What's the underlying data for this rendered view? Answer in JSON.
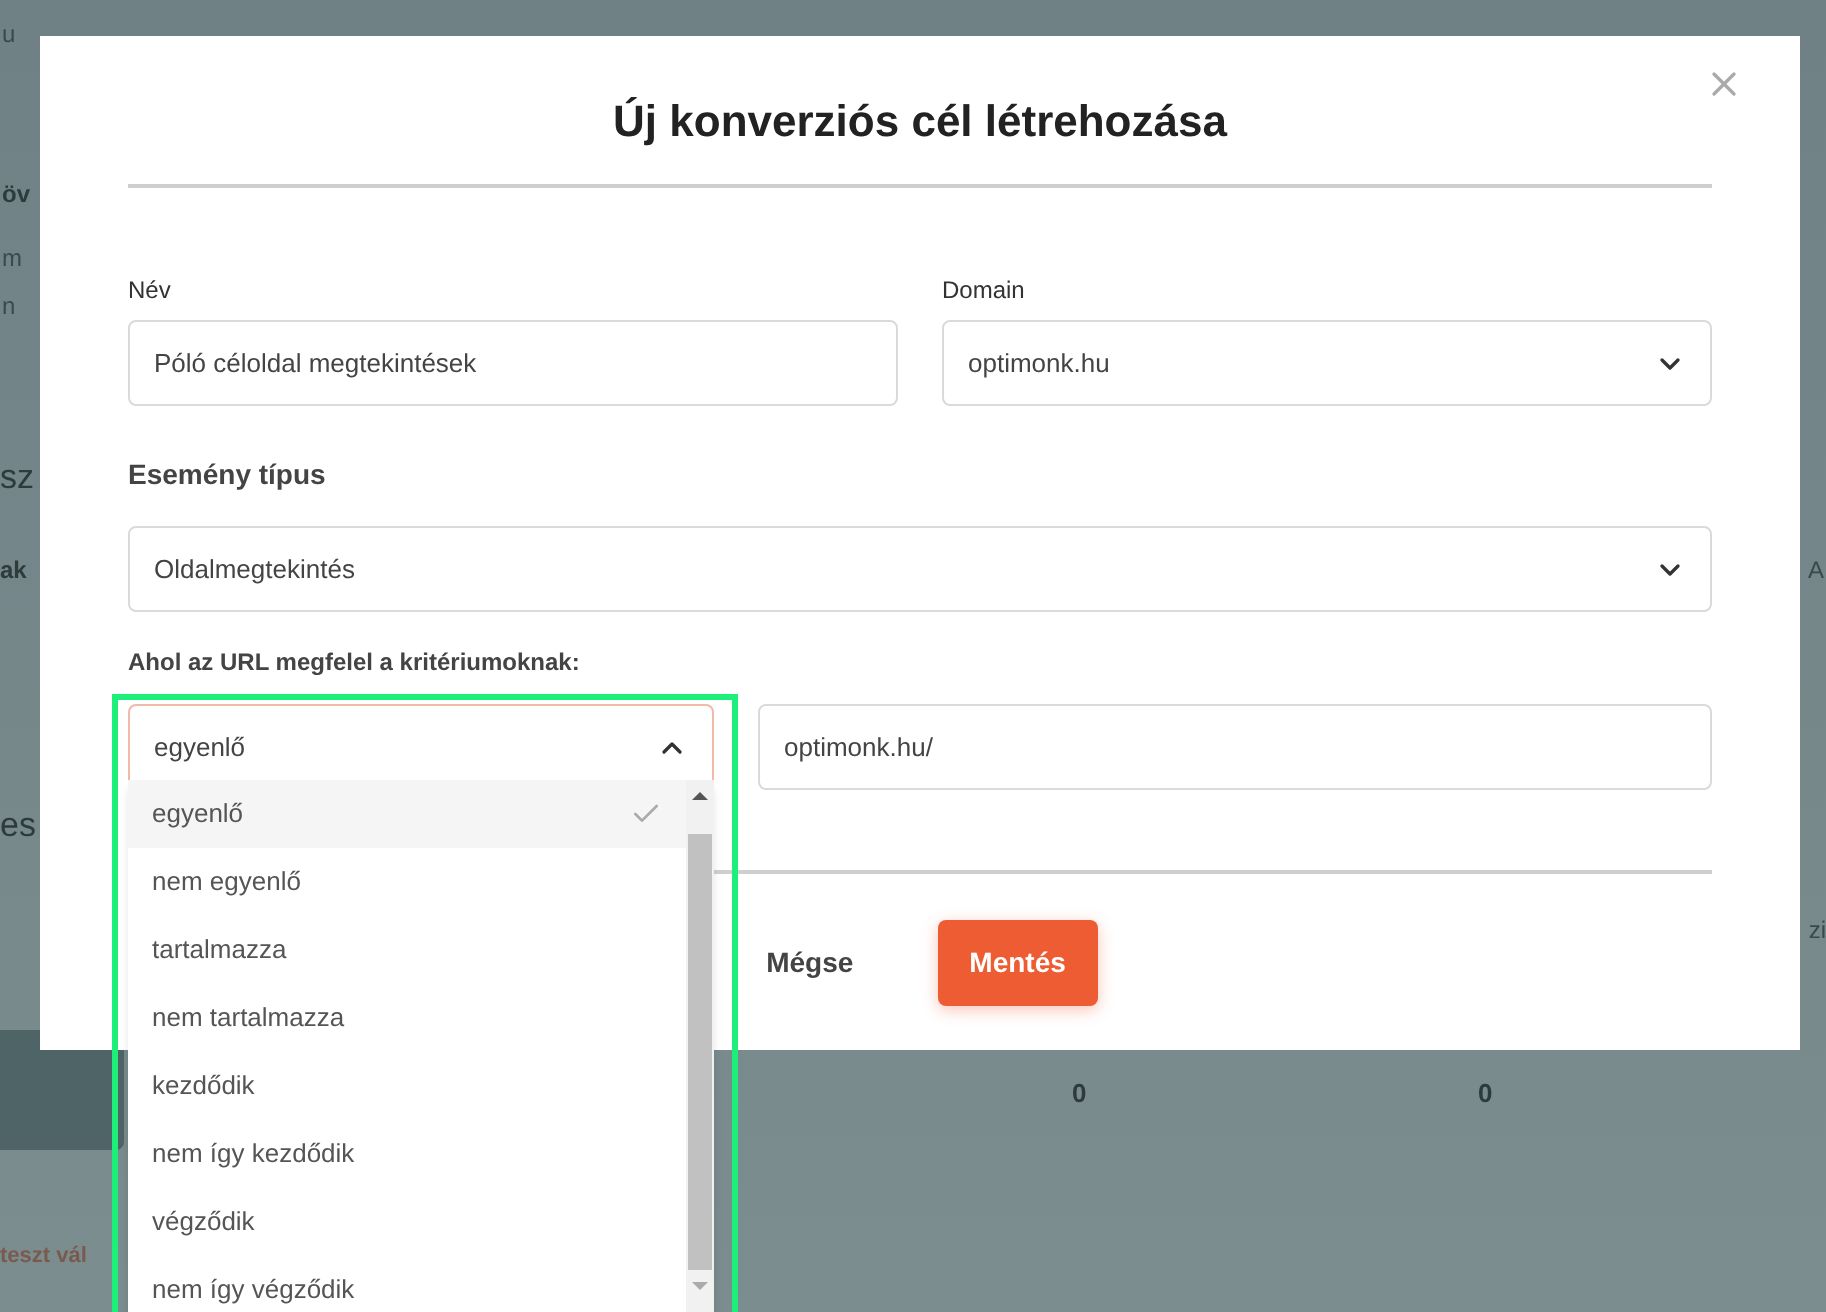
{
  "background": {
    "texts": [
      {
        "text": "u",
        "kind": "small"
      },
      {
        "text": "öv",
        "kind": "bold"
      },
      {
        "text": "m",
        "kind": "normal"
      },
      {
        "text": "n",
        "kind": "small"
      },
      {
        "text": "sz",
        "kind": "large"
      },
      {
        "text": "ak",
        "kind": "bold"
      },
      {
        "text": "es",
        "kind": "large"
      },
      {
        "text": "teszt vál",
        "kind": "link"
      },
      {
        "text": "0",
        "kind": "number"
      },
      {
        "text": "0",
        "kind": "number"
      },
      {
        "text": "A",
        "kind": "normal"
      },
      {
        "text": "zi",
        "kind": "normal"
      }
    ]
  },
  "modal": {
    "title": "Új konverziós cél létrehozása",
    "name_field": {
      "label": "Név",
      "value": "Póló céloldal megtekintések"
    },
    "domain_field": {
      "label": "Domain",
      "value": "optimonk.hu"
    },
    "event_type": {
      "label": "Esemény típus",
      "value": "Oldalmegtekintés"
    },
    "url_rule": {
      "label": "Ahol az URL megfelel a kritériumoknak:",
      "operator": {
        "value": "egyenlő",
        "expanded": true,
        "options": [
          {
            "label": "egyenlő",
            "selected": true
          },
          {
            "label": "nem egyenlő",
            "selected": false
          },
          {
            "label": "tartalmazza",
            "selected": false
          },
          {
            "label": "nem tartalmazza",
            "selected": false
          },
          {
            "label": "kezdődik",
            "selected": false
          },
          {
            "label": "nem így kezdődik",
            "selected": false
          },
          {
            "label": "végződik",
            "selected": false
          },
          {
            "label": "nem így végződik",
            "selected": false
          }
        ]
      },
      "url_value": "optimonk.hu/"
    },
    "buttons": {
      "cancel": "Mégse",
      "save": "Mentés"
    }
  }
}
